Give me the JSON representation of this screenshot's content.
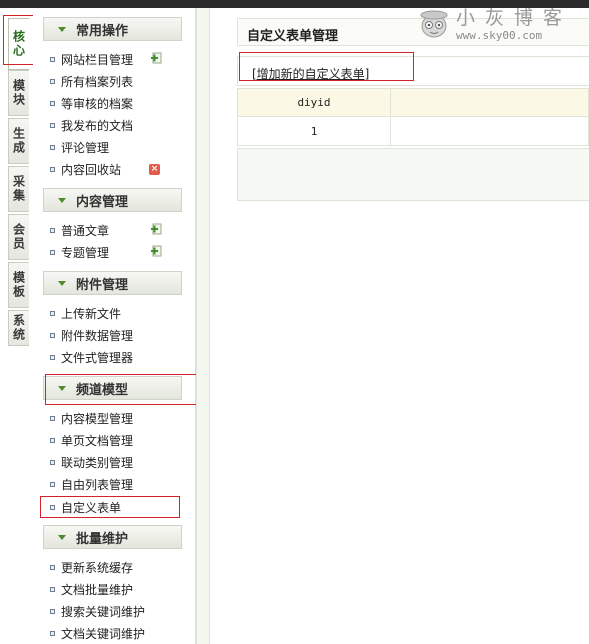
{
  "left_tabs": [
    "核心",
    "模块",
    "生成",
    "采集",
    "会员",
    "模板",
    "系统"
  ],
  "sections": [
    {
      "title": "常用操作",
      "items": [
        {
          "label": "网站栏目管理",
          "icon": "add-icon"
        },
        {
          "label": "所有档案列表"
        },
        {
          "label": "等审核的档案"
        },
        {
          "label": "我发布的文档"
        },
        {
          "label": "评论管理"
        },
        {
          "label": "内容回收站",
          "icon": "clear-icon"
        }
      ]
    },
    {
      "title": "内容管理",
      "items": [
        {
          "label": "普通文章",
          "icon": "add-icon"
        },
        {
          "label": "专题管理",
          "icon": "add-icon"
        }
      ]
    },
    {
      "title": "附件管理",
      "items": [
        {
          "label": "上传新文件"
        },
        {
          "label": "附件数据管理"
        },
        {
          "label": "文件式管理器"
        }
      ]
    },
    {
      "title": "频道模型",
      "items": [
        {
          "label": "内容模型管理"
        },
        {
          "label": "单页文档管理"
        },
        {
          "label": "联动类别管理"
        },
        {
          "label": "自由列表管理"
        },
        {
          "label": "自定义表单"
        }
      ]
    },
    {
      "title": "批量维护",
      "items": [
        {
          "label": "更新系统缓存"
        },
        {
          "label": "文档批量维护"
        },
        {
          "label": "搜索关键词维护"
        },
        {
          "label": "文档关键词维护"
        }
      ]
    }
  ],
  "main": {
    "page_title": "自定义表单管理",
    "add_link": "[增加新的自定义表单]",
    "table_header": [
      "diyid",
      ""
    ],
    "rows": [
      [
        "1",
        ""
      ]
    ]
  },
  "watermark": {
    "text": "小灰博客",
    "url": "www.sky00.com"
  },
  "colors": {
    "highlight_frame": "#d2232a",
    "accent_green": "#4f8a2b",
    "table_header_bg": "#fbf9e6"
  }
}
